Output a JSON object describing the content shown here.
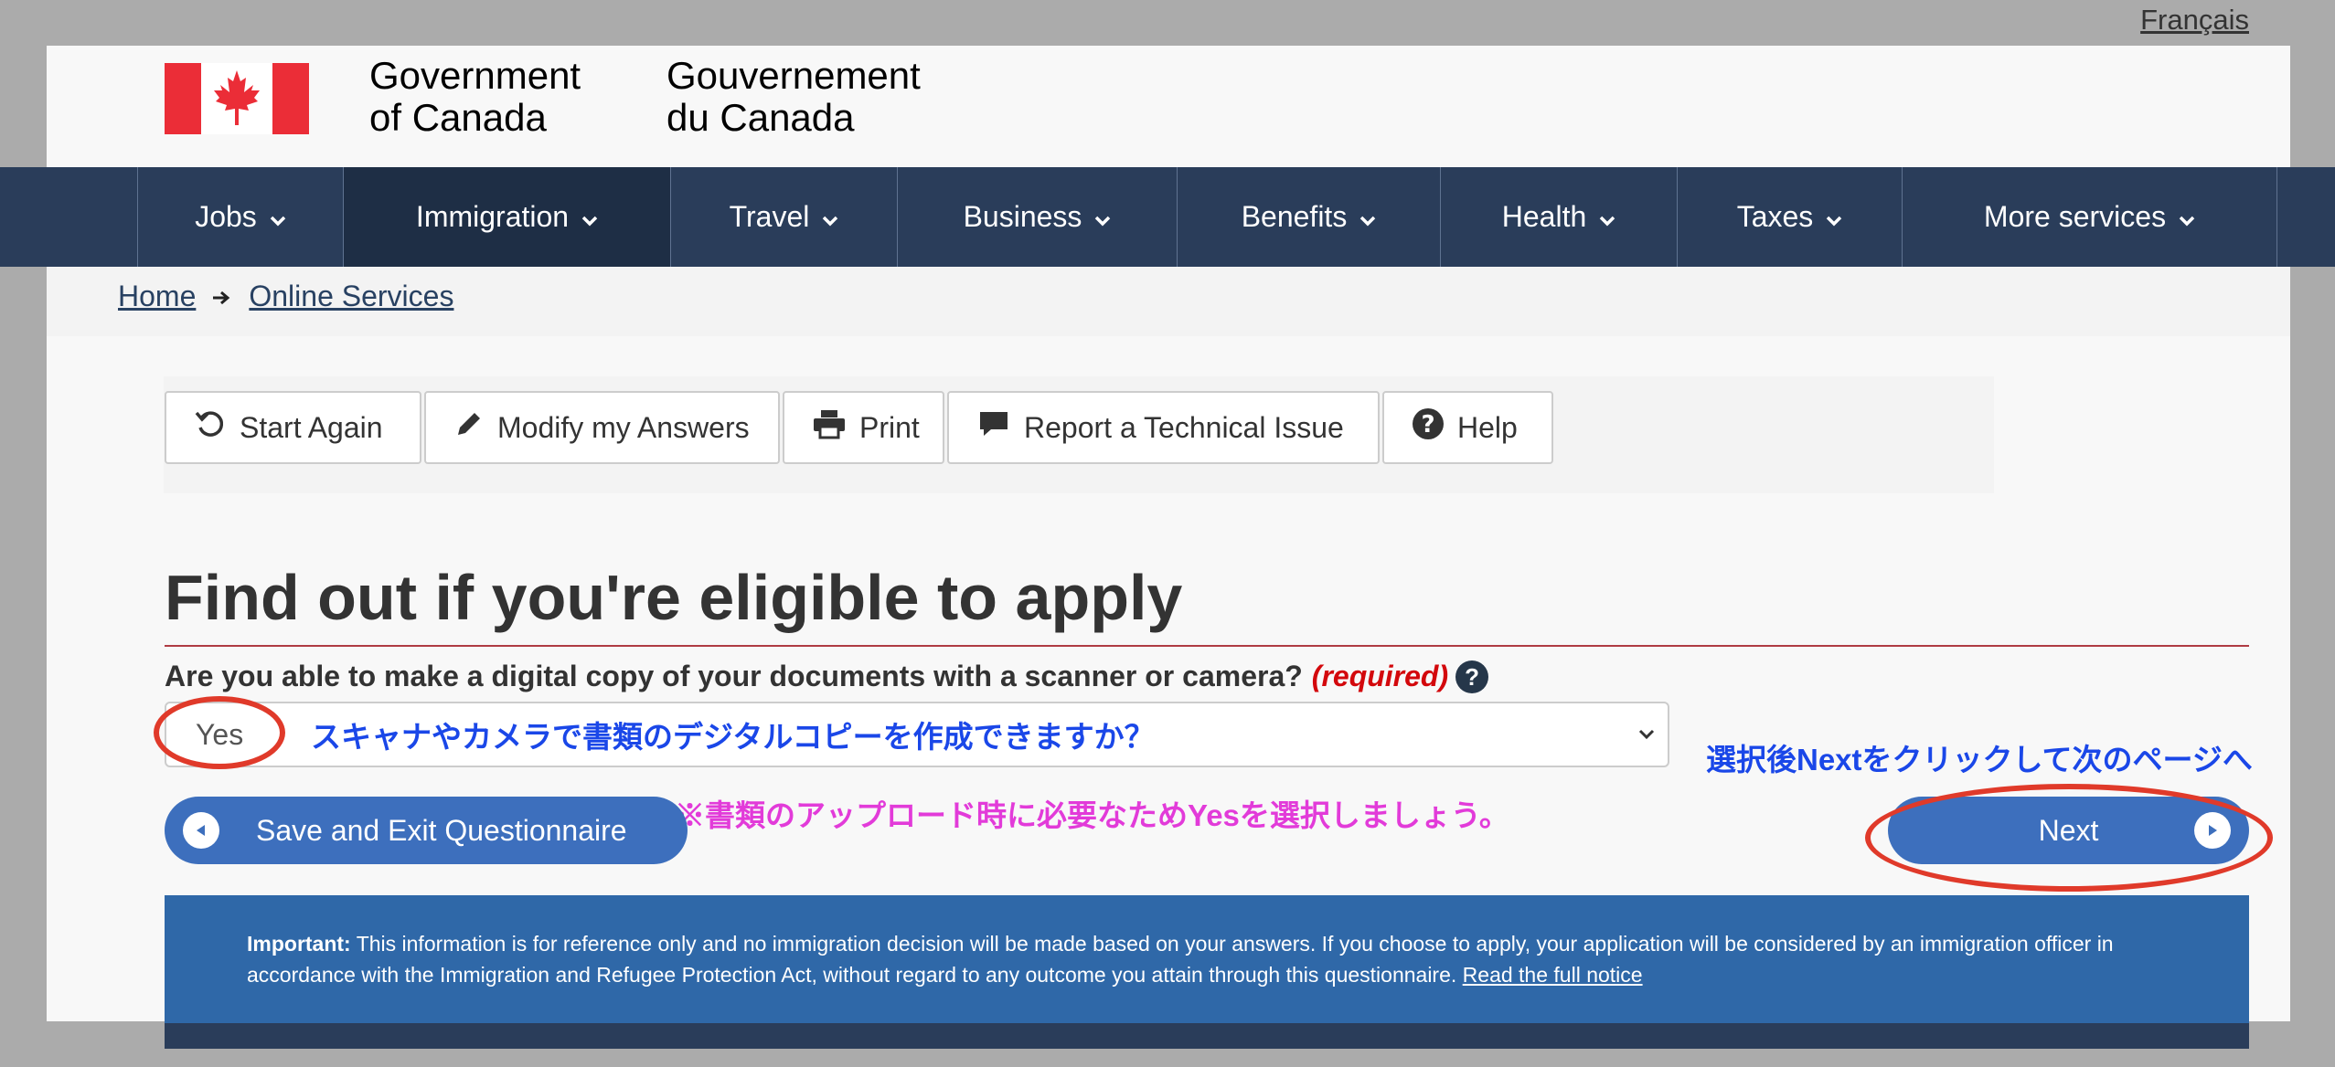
{
  "language_link": "Français",
  "header": {
    "signature_en_line1": "Government",
    "signature_en_line2": "of Canada",
    "signature_fr_line1": "Gouvernement",
    "signature_fr_line2": "du Canada"
  },
  "nav": {
    "items": [
      {
        "label": "Jobs"
      },
      {
        "label": "Immigration"
      },
      {
        "label": "Travel"
      },
      {
        "label": "Business"
      },
      {
        "label": "Benefits"
      },
      {
        "label": "Health"
      },
      {
        "label": "Taxes"
      },
      {
        "label": "More services"
      }
    ]
  },
  "breadcrumb": {
    "home": "Home",
    "online_services": "Online Services"
  },
  "toolbar": {
    "start_again": "Start Again",
    "modify": "Modify my Answers",
    "print": "Print",
    "report": "Report a Technical Issue",
    "help": "Help"
  },
  "page_title": "Find out if you're eligible to apply",
  "question": {
    "text": "Are you able to make a digital copy of your documents with a scanner or camera?",
    "required": "(required)",
    "help_icon": "?",
    "selected_value": "Yes"
  },
  "annotations": {
    "select_translation": "スキャナやカメラで書類のデジタルコピーを作成できますか？",
    "upload_note": "※書類のアップロード時に必要なためYesを選択しましょう。",
    "next_instruction": "選択後Nextをクリックして次のページへ"
  },
  "buttons": {
    "save_exit": "Save and Exit Questionnaire",
    "next": "Next"
  },
  "notice": {
    "label": "Important:",
    "text": " This information is for reference only and no immigration decision will be made based on your answers. If you choose to apply, your application will be considered by an immigration officer in accordance with the Immigration and Refugee Protection Act, without regard to any outcome you attain through this questionnaire. ",
    "link": "Read the full notice"
  },
  "colors": {
    "nav_bg": "#2a3d5a",
    "button_blue": "#3d6fbd",
    "notice_blue": "#2f68a8",
    "annotation_blue": "#1a47e8",
    "annotation_pink": "#e23bd9",
    "annotation_red": "#e03a2a",
    "required_red": "#d3080c"
  }
}
